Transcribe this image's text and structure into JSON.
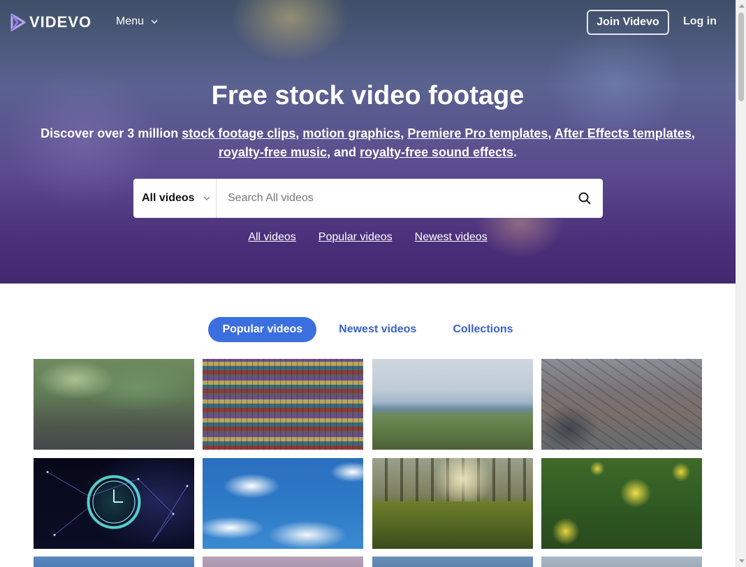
{
  "brand": {
    "name": "VIDEVO",
    "logo_icon": "videvo-play-logo"
  },
  "nav": {
    "menu_label": "Menu",
    "join_label": "Join Videvo",
    "login_label": "Log in"
  },
  "hero": {
    "title": "Free stock video footage",
    "sub_prefix": "Discover over 3 million ",
    "links": [
      "stock footage clips",
      "motion graphics",
      "Premiere Pro templates",
      "After Effects templates",
      "royalty-free music",
      "royalty-free sound effects"
    ],
    "sep": ", ",
    "and": ", and ",
    "period": "."
  },
  "search": {
    "category": "All videos",
    "placeholder": "Search All videos",
    "icon": "search-icon"
  },
  "quick_links": [
    "All videos",
    "Popular videos",
    "Newest videos"
  ],
  "tabs": [
    {
      "label": "Popular videos",
      "active": true
    },
    {
      "label": "Newest videos",
      "active": false
    },
    {
      "label": "Collections",
      "active": false
    }
  ],
  "thumbnails": [
    "rain-on-forest-floor",
    "shipping-containers-aerial",
    "coastline-cliffs",
    "city-aerial-view",
    "glowing-clock-network",
    "blue-sky-clouds",
    "sunlit-grass-forest",
    "yellow-daffodils"
  ],
  "colors": {
    "accent": "#3b6fe0",
    "tab_text": "#3a61c7",
    "hero_top": "#3e4f67",
    "hero_bottom": "#42296f"
  }
}
